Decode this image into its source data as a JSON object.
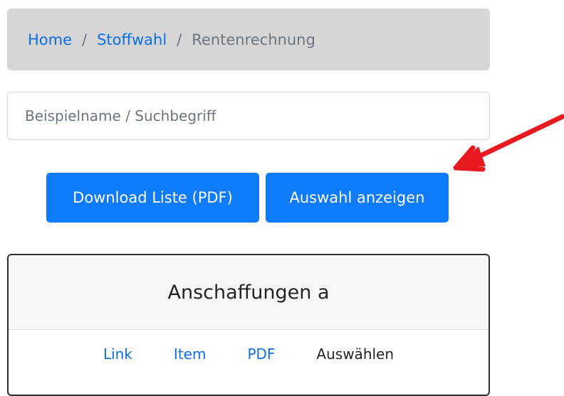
{
  "breadcrumb": {
    "home": "Home",
    "separator": "/",
    "stoffwahl": "Stoffwahl",
    "current": "Rentenrechnung"
  },
  "search": {
    "placeholder": "Beispielname / Suchbegriff",
    "value": ""
  },
  "buttons": {
    "download": "Download Liste (PDF)",
    "show_selection": "Auswahl anzeigen"
  },
  "card": {
    "title": "Anschaffungen a",
    "nav": {
      "link": "Link",
      "item": "Item",
      "pdf": "PDF",
      "select": "Auswählen"
    }
  },
  "colors": {
    "primary": "#0d7bfa",
    "link": "#0c6fe9",
    "annotation_arrow": "#e8191f"
  },
  "annotation": {
    "icon": "red-arrow-icon"
  }
}
